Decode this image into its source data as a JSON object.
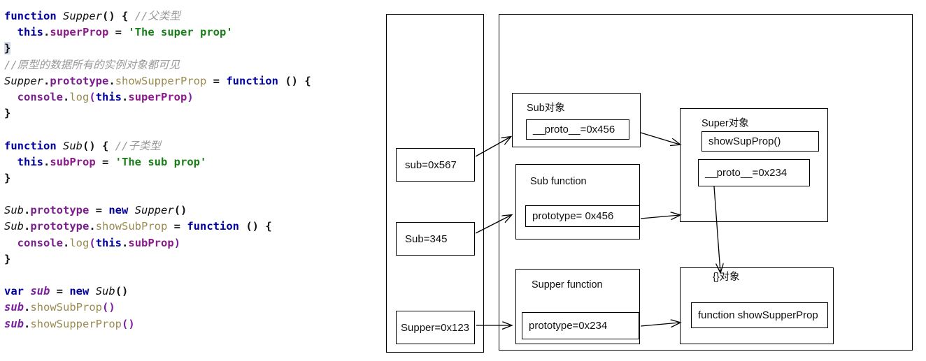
{
  "code": {
    "language": "javascript",
    "lines": [
      [
        {
          "t": "function",
          "c": "kw"
        },
        {
          "t": " ",
          "c": "plain"
        },
        {
          "t": "Supper",
          "c": "ident-i"
        },
        {
          "t": "() { ",
          "c": "punc"
        },
        {
          "t": "//父类型",
          "c": "cmt"
        }
      ],
      [
        {
          "t": "  ",
          "c": "plain"
        },
        {
          "t": "this",
          "c": "kw"
        },
        {
          "t": ".",
          "c": "punc"
        },
        {
          "t": "superProp",
          "c": "prop"
        },
        {
          "t": " = ",
          "c": "punc"
        },
        {
          "t": "'The super prop'",
          "c": "str"
        }
      ],
      [
        {
          "t": "}",
          "c": "brace-hl"
        }
      ],
      [
        {
          "t": "//原型的数据所有的实例对象都可见",
          "c": "cmt"
        }
      ],
      [
        {
          "t": "Supper",
          "c": "ident-i"
        },
        {
          "t": ".",
          "c": "punc"
        },
        {
          "t": "prototype",
          "c": "prop2"
        },
        {
          "t": ".",
          "c": "punc"
        },
        {
          "t": "showSupperProp",
          "c": "meth"
        },
        {
          "t": " = ",
          "c": "punc"
        },
        {
          "t": "function",
          "c": "kw"
        },
        {
          "t": " () {",
          "c": "punc"
        }
      ],
      [
        {
          "t": "  ",
          "c": "plain"
        },
        {
          "t": "console",
          "c": "prop2"
        },
        {
          "t": ".",
          "c": "punc"
        },
        {
          "t": "log",
          "c": "meth"
        },
        {
          "t": "(",
          "c": "paren"
        },
        {
          "t": "this",
          "c": "kw"
        },
        {
          "t": ".",
          "c": "punc"
        },
        {
          "t": "superProp",
          "c": "prop"
        },
        {
          "t": ")",
          "c": "paren"
        }
      ],
      [
        {
          "t": "}",
          "c": "punc"
        }
      ],
      [
        {
          "t": "",
          "c": "plain"
        }
      ],
      [
        {
          "t": "function",
          "c": "kw"
        },
        {
          "t": " ",
          "c": "plain"
        },
        {
          "t": "Sub",
          "c": "ident-i"
        },
        {
          "t": "() { ",
          "c": "punc"
        },
        {
          "t": "//子类型",
          "c": "cmt"
        }
      ],
      [
        {
          "t": "  ",
          "c": "plain"
        },
        {
          "t": "this",
          "c": "kw"
        },
        {
          "t": ".",
          "c": "punc"
        },
        {
          "t": "subProp",
          "c": "prop"
        },
        {
          "t": " = ",
          "c": "punc"
        },
        {
          "t": "'The sub prop'",
          "c": "str"
        }
      ],
      [
        {
          "t": "}",
          "c": "punc"
        }
      ],
      [
        {
          "t": "",
          "c": "plain"
        }
      ],
      [
        {
          "t": "Sub",
          "c": "ident-i"
        },
        {
          "t": ".",
          "c": "punc"
        },
        {
          "t": "prototype",
          "c": "prop2"
        },
        {
          "t": " = ",
          "c": "punc"
        },
        {
          "t": "new",
          "c": "kw"
        },
        {
          "t": " ",
          "c": "plain"
        },
        {
          "t": "Supper",
          "c": "ident-i"
        },
        {
          "t": "()",
          "c": "punc"
        }
      ],
      [
        {
          "t": "Sub",
          "c": "ident-i"
        },
        {
          "t": ".",
          "c": "punc"
        },
        {
          "t": "prototype",
          "c": "prop2"
        },
        {
          "t": ".",
          "c": "punc"
        },
        {
          "t": "showSubProp",
          "c": "meth"
        },
        {
          "t": " = ",
          "c": "punc"
        },
        {
          "t": "function",
          "c": "kw"
        },
        {
          "t": " () {",
          "c": "punc"
        }
      ],
      [
        {
          "t": "  ",
          "c": "plain"
        },
        {
          "t": "console",
          "c": "prop2"
        },
        {
          "t": ".",
          "c": "punc"
        },
        {
          "t": "log",
          "c": "meth"
        },
        {
          "t": "(",
          "c": "paren"
        },
        {
          "t": "this",
          "c": "kw"
        },
        {
          "t": ".",
          "c": "punc"
        },
        {
          "t": "subProp",
          "c": "prop"
        },
        {
          "t": ")",
          "c": "paren"
        }
      ],
      [
        {
          "t": "}",
          "c": "punc"
        }
      ],
      [
        {
          "t": "",
          "c": "plain"
        }
      ],
      [
        {
          "t": "var",
          "c": "kw"
        },
        {
          "t": " ",
          "c": "plain"
        },
        {
          "t": "sub",
          "c": "var-i"
        },
        {
          "t": " = ",
          "c": "punc"
        },
        {
          "t": "new",
          "c": "kw"
        },
        {
          "t": " ",
          "c": "plain"
        },
        {
          "t": "Sub",
          "c": "ident-i"
        },
        {
          "t": "()",
          "c": "punc"
        }
      ],
      [
        {
          "t": "sub",
          "c": "var-i"
        },
        {
          "t": ".",
          "c": "punc"
        },
        {
          "t": "showSubProp",
          "c": "meth"
        },
        {
          "t": "()",
          "c": "paren"
        }
      ],
      [
        {
          "t": "sub",
          "c": "var-i"
        },
        {
          "t": ".",
          "c": "punc"
        },
        {
          "t": "showSupperProp",
          "c": "meth"
        },
        {
          "t": "()",
          "c": "paren"
        }
      ]
    ]
  },
  "diagram": {
    "stack_panel": {
      "title": ""
    },
    "heap_panel": {
      "title": ""
    },
    "stack_cells": [
      {
        "label": "sub=0x567"
      },
      {
        "label": "Sub=345"
      },
      {
        "label": "Supper=0x123"
      }
    ],
    "heap_boxes": [
      {
        "title": "Sub对象",
        "slots": [
          {
            "label": "__proto__=0x456"
          }
        ]
      },
      {
        "title": "Sub function",
        "slots": [
          {
            "label": "prototype= 0x456"
          }
        ]
      },
      {
        "title": "Supper function",
        "slots": [
          {
            "label": "prototype=0x234"
          }
        ]
      },
      {
        "title": "Super对象",
        "slots": [
          {
            "label": "showSupProp()"
          },
          {
            "label": "__proto__=0x234"
          }
        ]
      },
      {
        "title": "{}对象",
        "slots": [
          {
            "label": "function showSupperProp"
          }
        ]
      }
    ],
    "colors": {
      "stroke": "#000000",
      "background": "#ffffff",
      "text": "#111111"
    }
  }
}
